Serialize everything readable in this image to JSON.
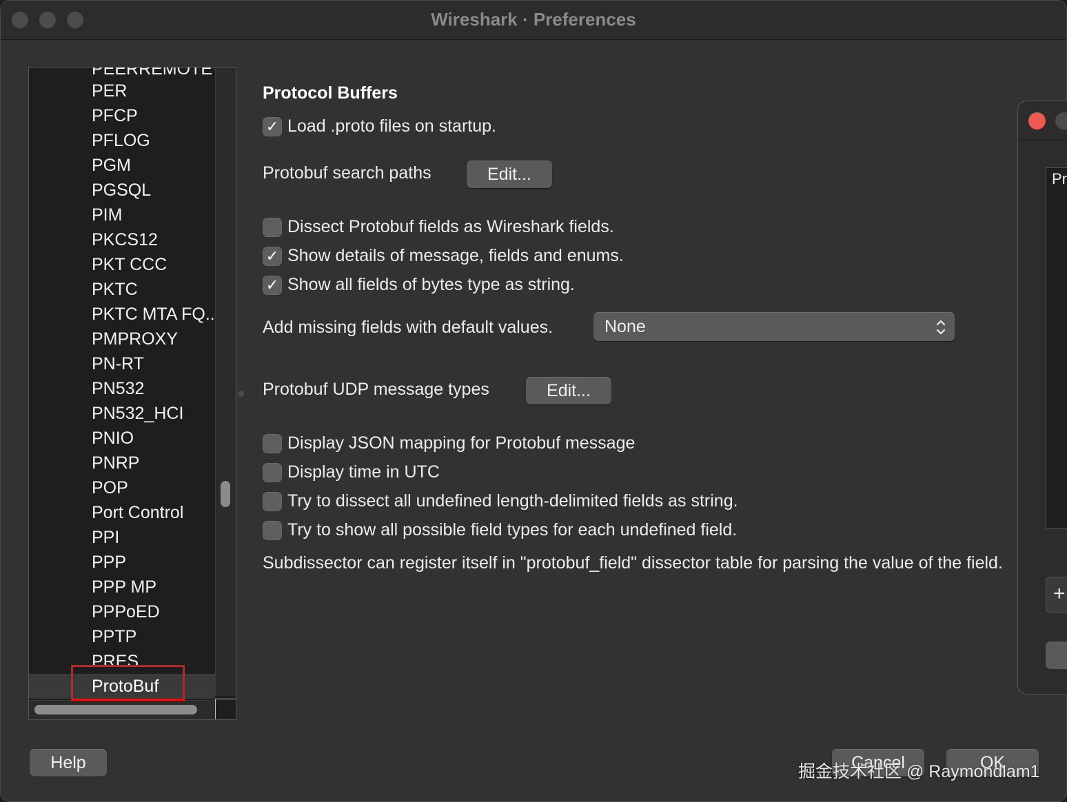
{
  "window": {
    "title": "Wireshark · Preferences"
  },
  "tree": {
    "items": [
      "PER",
      "PFCP",
      "PFLOG",
      "PGM",
      "PGSQL",
      "PIM",
      "PKCS12",
      "PKT CCC",
      "PKTC",
      "PKTC MTA FQ..",
      "PMPROXY",
      "PN-RT",
      "PN532",
      "PN532_HCI",
      "PNIO",
      "PNRP",
      "POP",
      "Port Control",
      "PPI",
      "PPP",
      "PPP MP",
      "PPPoED",
      "PPTP",
      "PRES"
    ],
    "partial_top": "PEERREMOTE",
    "selected": "ProtoBuf"
  },
  "prefs": {
    "section_title": "Protocol Buffers",
    "load_proto": {
      "label": "Load .proto files on startup.",
      "checked": true
    },
    "search_paths": {
      "label": "Protobuf search paths",
      "button": "Edit..."
    },
    "dissect_fields": {
      "label": "Dissect Protobuf fields as Wireshark fields.",
      "checked": false
    },
    "show_details": {
      "label": "Show details of message, fields and enums.",
      "checked": true
    },
    "bytes_as_string": {
      "label": "Show all fields of bytes type as string.",
      "checked": true
    },
    "missing_fields": {
      "label": "Add missing fields with default values.",
      "value": "None"
    },
    "udp_types": {
      "label": "Protobuf UDP message types",
      "button": "Edit..."
    },
    "json_mapping": {
      "label": "Display JSON mapping for Protobuf message",
      "checked": false
    },
    "time_utc": {
      "label": "Display time in UTC",
      "checked": false
    },
    "undefined_string": {
      "label": "Try to dissect all undefined length-delimited fields as string.",
      "checked": false
    },
    "all_types": {
      "label": "Try to show all possible field types for each undefined field.",
      "checked": false
    },
    "description": "Subdissector can register itself in \"protobuf_field\" dissector table for parsing the value of the field."
  },
  "footer": {
    "help": "Help",
    "cancel": "Cancel",
    "ok": "OK"
  },
  "side_dialog": {
    "label": "Pr",
    "plus": "+"
  },
  "watermark": "掘金技术社区 @ Raymondlam1",
  "colors": {
    "highlight": "#e01515",
    "close": "#ec5a52"
  }
}
